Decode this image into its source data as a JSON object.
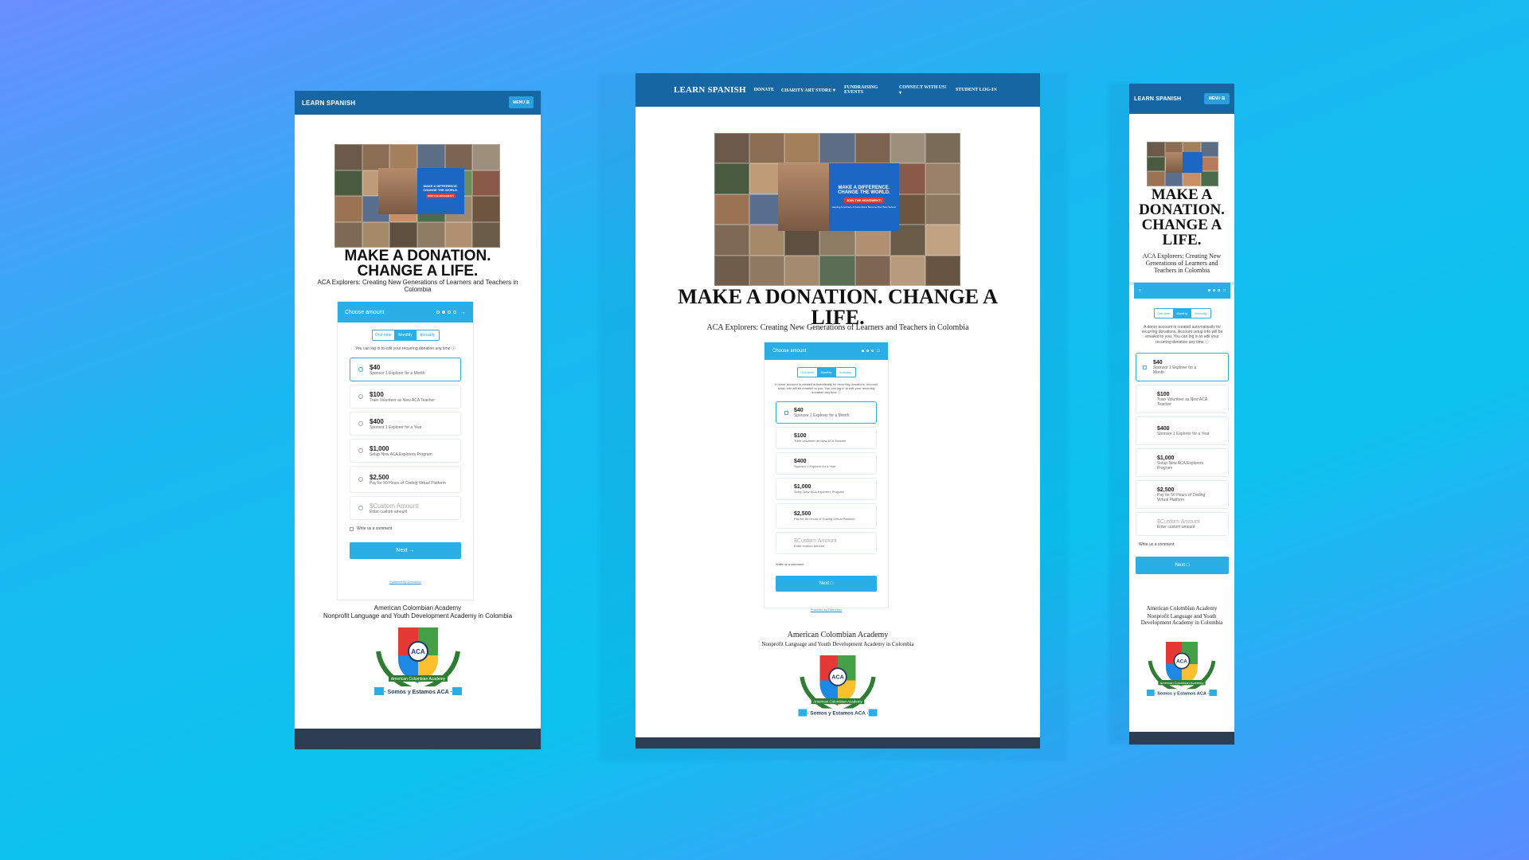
{
  "colors": {
    "nav": "#1566a3",
    "accent": "#29aee6",
    "footer": "#2e3e52"
  },
  "brand": "LEARN SPANISH",
  "menu_label": "MENU ☰",
  "desktop_nav": [
    "DONATE",
    "CHARITY ART STORE ▾",
    "FUNDRAISING EVENTS",
    "CONNECT WITH US! ▾",
    "STUDENT LOG-IN"
  ],
  "hero": {
    "poster_title_1": "MAKE A DIFFERENCE.",
    "poster_title_2": "CHANGE THE WORLD.",
    "poster_cta": "JOIN THE MOVEMENT!",
    "poster_sub": "Helping Americans & Colombians Become their Best Selves!"
  },
  "headline": "MAKE A DONATION. CHANGE A LIFE.",
  "headline_tall": "MAKE A DONATION. CHANGE A LIFE.",
  "subline": "ACA Explorers: Creating New Generations of Learners and Teachers in Colombia",
  "widget": {
    "title": "Choose amount",
    "frequencies": [
      "One-time",
      "Monthly",
      "Annually"
    ],
    "note_short": "You can log in to edit your recurring donation any time ⓘ",
    "note_long": "A donor account is created automatically for recurring donations. Account setup info will be emailed to you. You can log in to edit your recurring donation any time ⓘ",
    "options": [
      {
        "amount": "$40",
        "desc": "Sponsor 1 Explorer for a Month"
      },
      {
        "amount": "$100",
        "desc": "Train Volunteer as New ACA Teacher"
      },
      {
        "amount": "$400",
        "desc": "Sponsor 1 Explorer for a Year"
      },
      {
        "amount": "$1,000",
        "desc": "Setup New ACA Explorers Program"
      },
      {
        "amount": "$2,500",
        "desc": "Pay for 50 Hours of Coding Virtual Platform"
      }
    ],
    "custom": {
      "amount": "$Custom Amount",
      "desc": "Enter custom amount"
    },
    "comment": "Write us a comment",
    "next": "Next",
    "powered": "Powered by Donorbox"
  },
  "org_name": "American Colombian Academy",
  "org_tagline": "Nonprofit Language and Youth Development Academy in Colombia",
  "crest": {
    "letters": "ACA",
    "banner": "American Colombian Academy",
    "motto": "· Somos y Estamos ACA ·"
  }
}
